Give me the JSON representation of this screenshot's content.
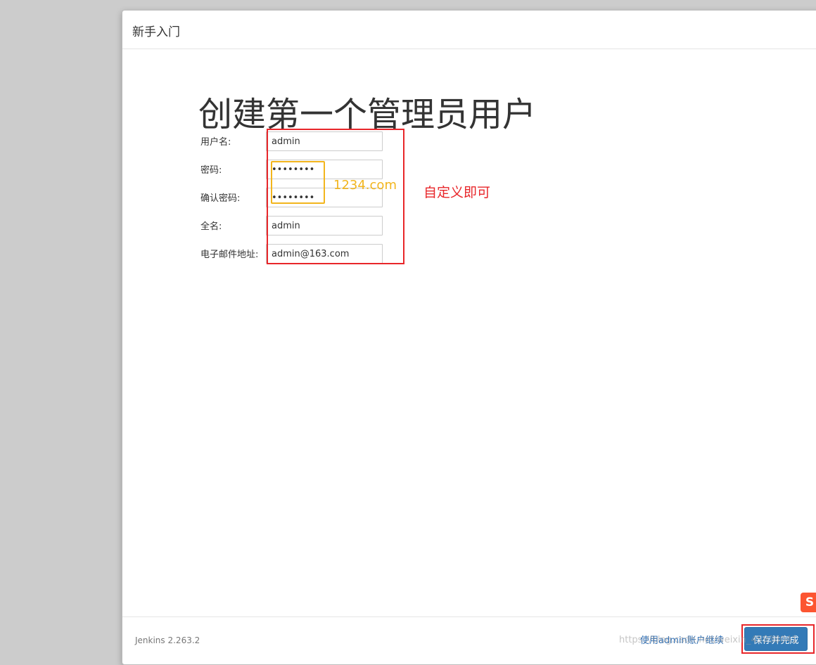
{
  "dialog": {
    "title": "新手入门",
    "heading": "创建第一个管理员用户"
  },
  "form": {
    "fields": [
      {
        "label": "用户名:",
        "value": "admin",
        "type": "text"
      },
      {
        "label": "密码:",
        "value": "••••••••",
        "type": "password"
      },
      {
        "label": "确认密码:",
        "value": "••••••••",
        "type": "password"
      },
      {
        "label": "全名:",
        "value": "admin",
        "type": "text"
      },
      {
        "label": "电子邮件地址:",
        "value": "admin@163.com",
        "type": "text"
      }
    ]
  },
  "annotations": {
    "password_hint": "1234.com",
    "note": "自定义即可",
    "colors": {
      "red": "#e8262a",
      "yellow": "#f2b51d"
    }
  },
  "footer": {
    "version": "Jenkins 2.263.2",
    "continue_link": "使用admin账户继续",
    "save_button": "保存并完成"
  },
  "watermark": "https://blog.csdn.net/weixin_45938041",
  "logo_text": "S"
}
